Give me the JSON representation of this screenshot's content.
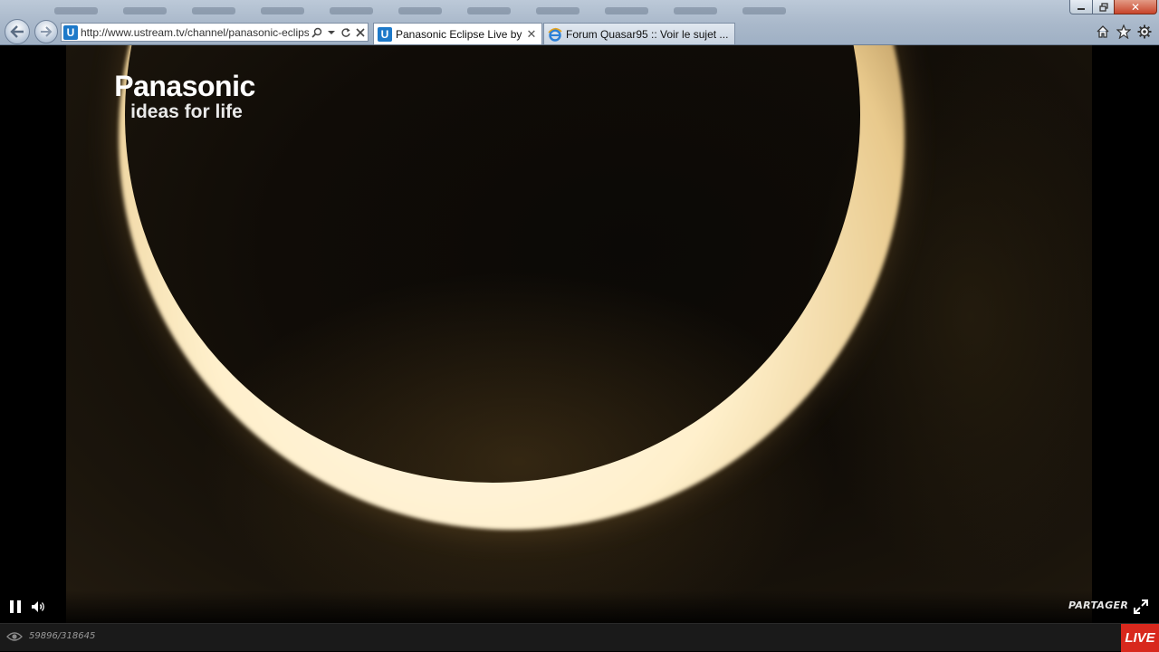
{
  "browser": {
    "address_url": "http://www.ustream.tv/channel/panasonic-eclipse",
    "tabs": [
      {
        "title": "Panasonic Eclipse Live by S...",
        "favicon": "ustream-icon",
        "active": true
      },
      {
        "title": "Forum Quasar95 :: Voir le sujet ...",
        "favicon": "ie-icon",
        "active": false
      }
    ],
    "window_close": "✕"
  },
  "video": {
    "logo_brand": "Panasonic",
    "logo_tagline": "ideas for life",
    "colors": {
      "crescent": "#fff3d4",
      "sky": "#100c07"
    }
  },
  "controls": {
    "share_label": "PARTAGER"
  },
  "status": {
    "viewers": "59896/318645",
    "live_label": "LIVE",
    "live_color": "#d8281d"
  }
}
